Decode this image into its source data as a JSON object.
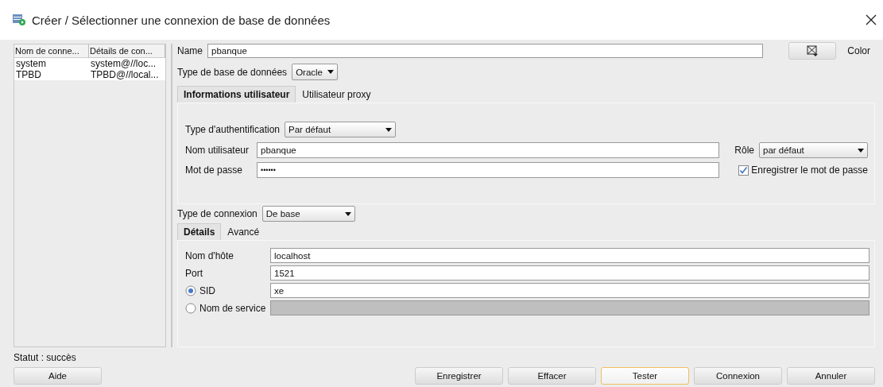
{
  "window": {
    "title": "Créer / Sélectionner une connexion de base de données"
  },
  "connections": {
    "columns": [
      "Nom de conne...",
      "Détails de con..."
    ],
    "rows": [
      {
        "cells": [
          "system",
          "system@//loc..."
        ]
      },
      {
        "cells": [
          "TPBD",
          "TPBD@//local..."
        ]
      }
    ]
  },
  "name_field": {
    "label": "Name",
    "value": "pbanque"
  },
  "color_button": {
    "label": "Color"
  },
  "db_type": {
    "label": "Type de base de données",
    "value": "Oracle"
  },
  "tabs": [
    {
      "label": "Informations utilisateur",
      "selected": true
    },
    {
      "label": "Utilisateur proxy",
      "selected": false
    }
  ],
  "auth": {
    "label": "Type d'authentification",
    "value": "Par défaut"
  },
  "username": {
    "label": "Nom utilisateur",
    "value": "pbanque"
  },
  "role": {
    "label": "Rôle",
    "value": "par défaut"
  },
  "password": {
    "label": "Mot de passe",
    "value": "••••••"
  },
  "save_password": {
    "label": "Enregistrer le mot de passe",
    "checked": true
  },
  "connection_type": {
    "label": "Type de connexion",
    "value": "De base"
  },
  "detail_tabs": [
    {
      "label": "Détails",
      "selected": true
    },
    {
      "label": "Avancé",
      "selected": false
    }
  ],
  "details": [
    {
      "kind": "text",
      "label": "Nom d'hôte",
      "value": "localhost",
      "disabled": false
    },
    {
      "kind": "text",
      "label": "Port",
      "value": "1521",
      "disabled": false
    },
    {
      "kind": "radio",
      "label": "SID",
      "value": "xe",
      "selected": true,
      "disabled": false
    },
    {
      "kind": "radio",
      "label": "Nom de service",
      "selected": false,
      "disabled": true
    }
  ],
  "status": "Statut : succès",
  "help_button": {
    "label": "Aide"
  },
  "buttons": [
    {
      "label": "Enregistrer",
      "focused": false
    },
    {
      "label": "Effacer",
      "focused": false
    },
    {
      "label": "Tester",
      "focused": true
    },
    {
      "label": "Connexion",
      "focused": false
    },
    {
      "label": "Annuler",
      "focused": false
    }
  ]
}
